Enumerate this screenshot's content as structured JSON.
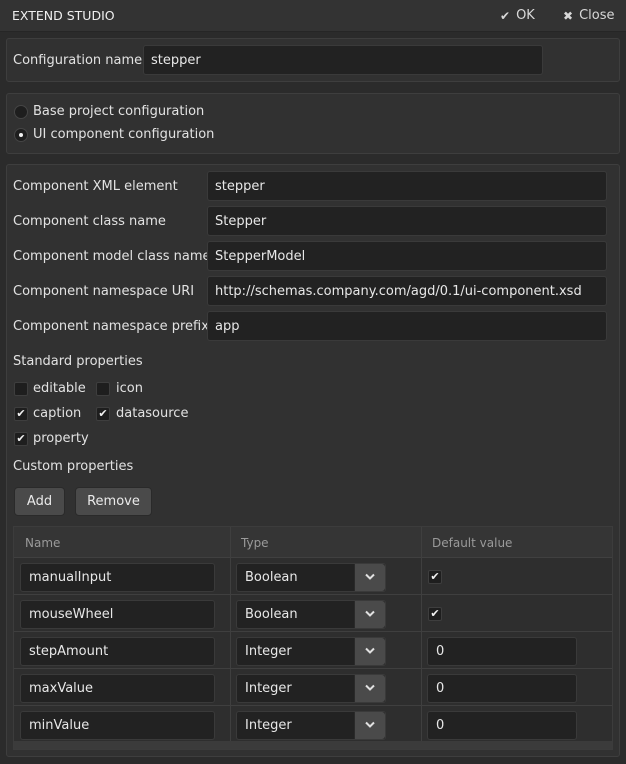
{
  "window": {
    "title": "EXTEND STUDIO",
    "ok_label": "OK",
    "close_label": "Close"
  },
  "config": {
    "name_label": "Configuration name",
    "name_value": "stepper"
  },
  "mode": {
    "base_label": "Base project configuration",
    "ui_label": "UI component configuration",
    "selected": "ui"
  },
  "component": {
    "xml_label": "Component XML element",
    "xml_value": "stepper",
    "class_label": "Component class name",
    "class_value": "Stepper",
    "model_label": "Component model class name",
    "model_value": "StepperModel",
    "ns_uri_label": "Component namespace URI",
    "ns_uri_value": "http://schemas.company.com/agd/0.1/ui-component.xsd",
    "ns_prefix_label": "Component namespace prefix",
    "ns_prefix_value": "app"
  },
  "standard": {
    "heading": "Standard properties",
    "items": [
      {
        "label": "editable",
        "checked": false
      },
      {
        "label": "icon",
        "checked": false
      },
      {
        "label": "caption",
        "checked": true
      },
      {
        "label": "datasource",
        "checked": true
      },
      {
        "label": "property",
        "checked": true
      }
    ]
  },
  "custom": {
    "heading": "Custom properties",
    "add_label": "Add",
    "remove_label": "Remove",
    "columns": [
      "Name",
      "Type",
      "Default value"
    ],
    "rows": [
      {
        "name": "manualInput",
        "type": "Boolean",
        "default": true
      },
      {
        "name": "mouseWheel",
        "type": "Boolean",
        "default": true
      },
      {
        "name": "stepAmount",
        "type": "Integer",
        "default": "0"
      },
      {
        "name": "maxValue",
        "type": "Integer",
        "default": "0"
      },
      {
        "name": "minValue",
        "type": "Integer",
        "default": "0"
      }
    ]
  }
}
